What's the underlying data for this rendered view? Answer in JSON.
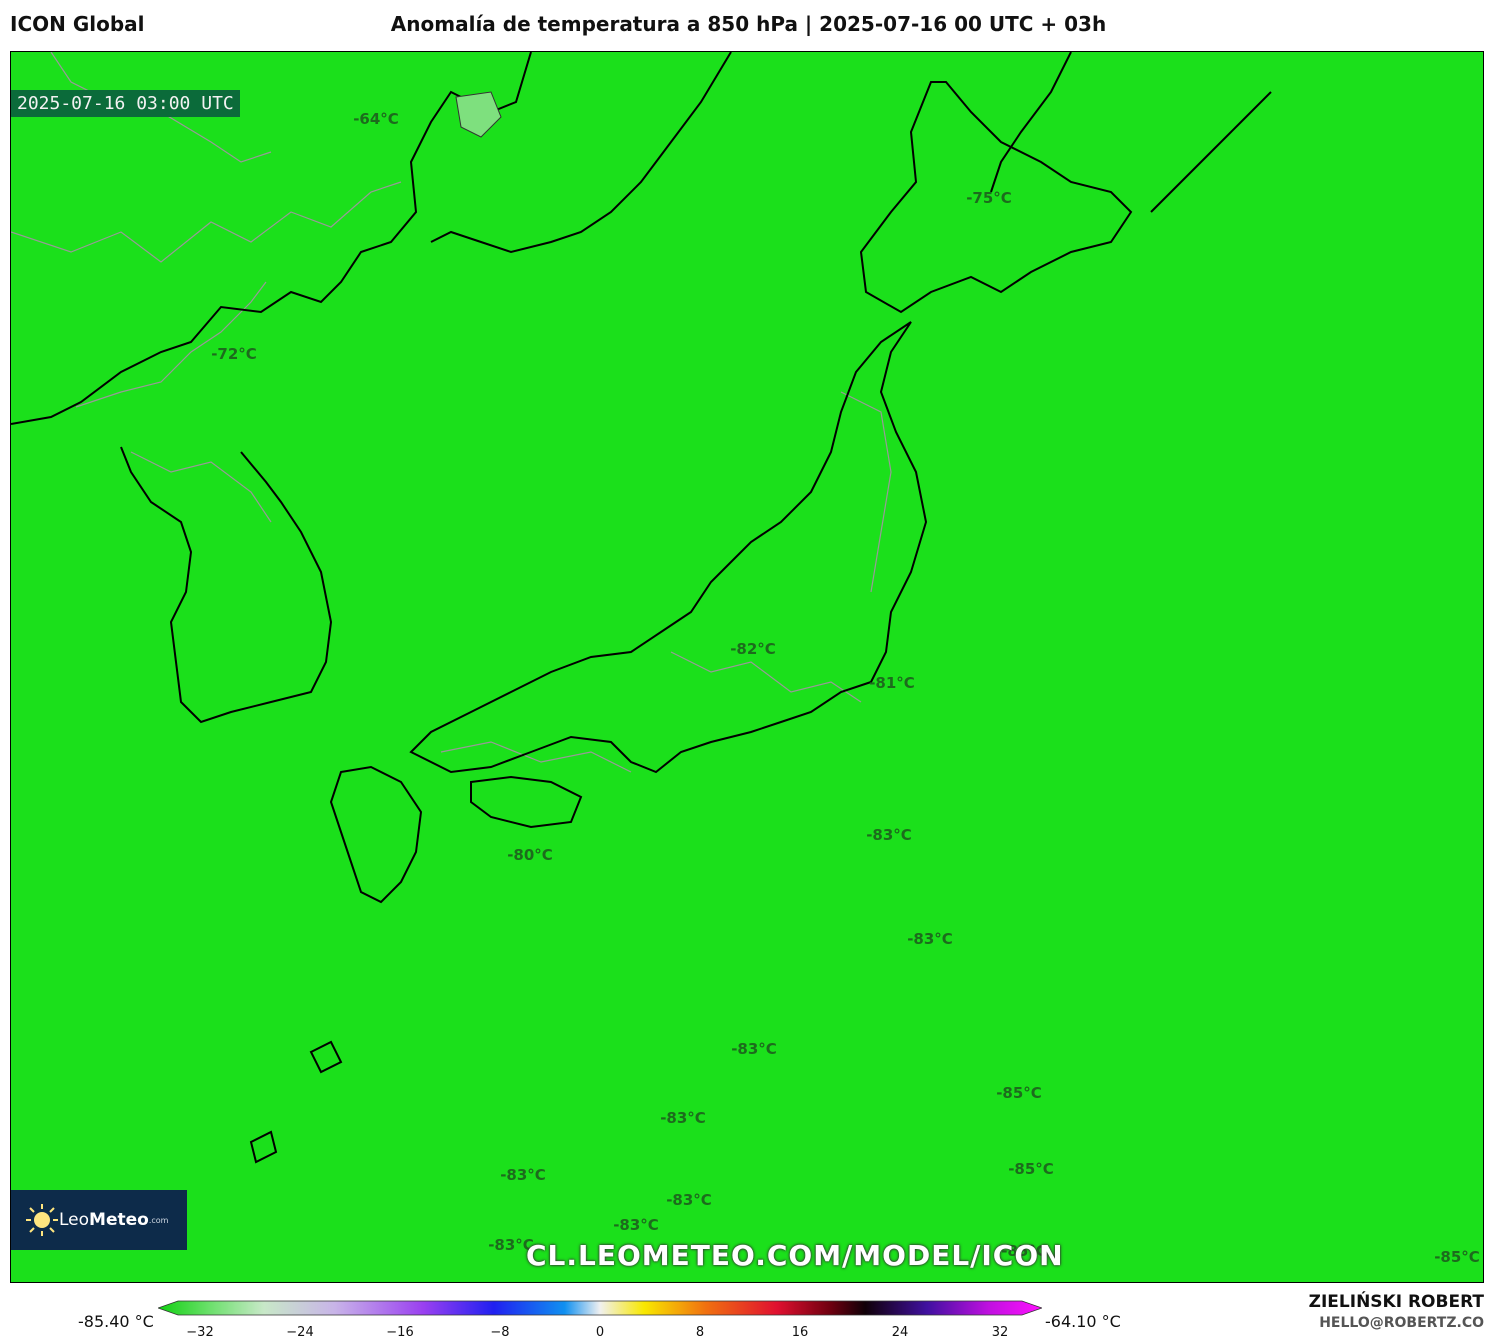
{
  "header": {
    "model": "ICON Global",
    "title": "Anomalía de temperatura a 850 hPa | 2025-07-16 00 UTC + 03h"
  },
  "map": {
    "valid_time": "2025-07-16 03:00 UTC",
    "background_color": "#1be01b",
    "labels": [
      {
        "text": "-64°C"
      },
      {
        "text": "-75°C"
      },
      {
        "text": "-72°C"
      },
      {
        "text": "-82°C"
      },
      {
        "text": "-81°C"
      },
      {
        "text": "-83°C"
      },
      {
        "text": "-80°C"
      },
      {
        "text": "-83°C"
      },
      {
        "text": "-83°C"
      },
      {
        "text": "-85°C"
      },
      {
        "text": "-83°C"
      },
      {
        "text": "-85°C"
      },
      {
        "text": "-83°C"
      },
      {
        "text": "-83°C"
      },
      {
        "text": "-83°C"
      },
      {
        "text": "-83°C"
      },
      {
        "text": "-85°C"
      },
      {
        "text": "-85°C"
      }
    ],
    "watermark": "CL.LEOMETEO.COM/MODEL/ICON",
    "logo": {
      "leo": "Leo",
      "meteo": "Meteo",
      "com": ".com"
    }
  },
  "colorbar": {
    "min_label": "-85.40 °C",
    "max_label": "-64.10 °C",
    "ticks": [
      "−32",
      "−24",
      "−16",
      "−8",
      "0",
      "8",
      "16",
      "24",
      "32"
    ]
  },
  "credits": {
    "author": "ZIELIŃSKI ROBERT",
    "email": "HELLO@ROBERTZ.CO"
  }
}
